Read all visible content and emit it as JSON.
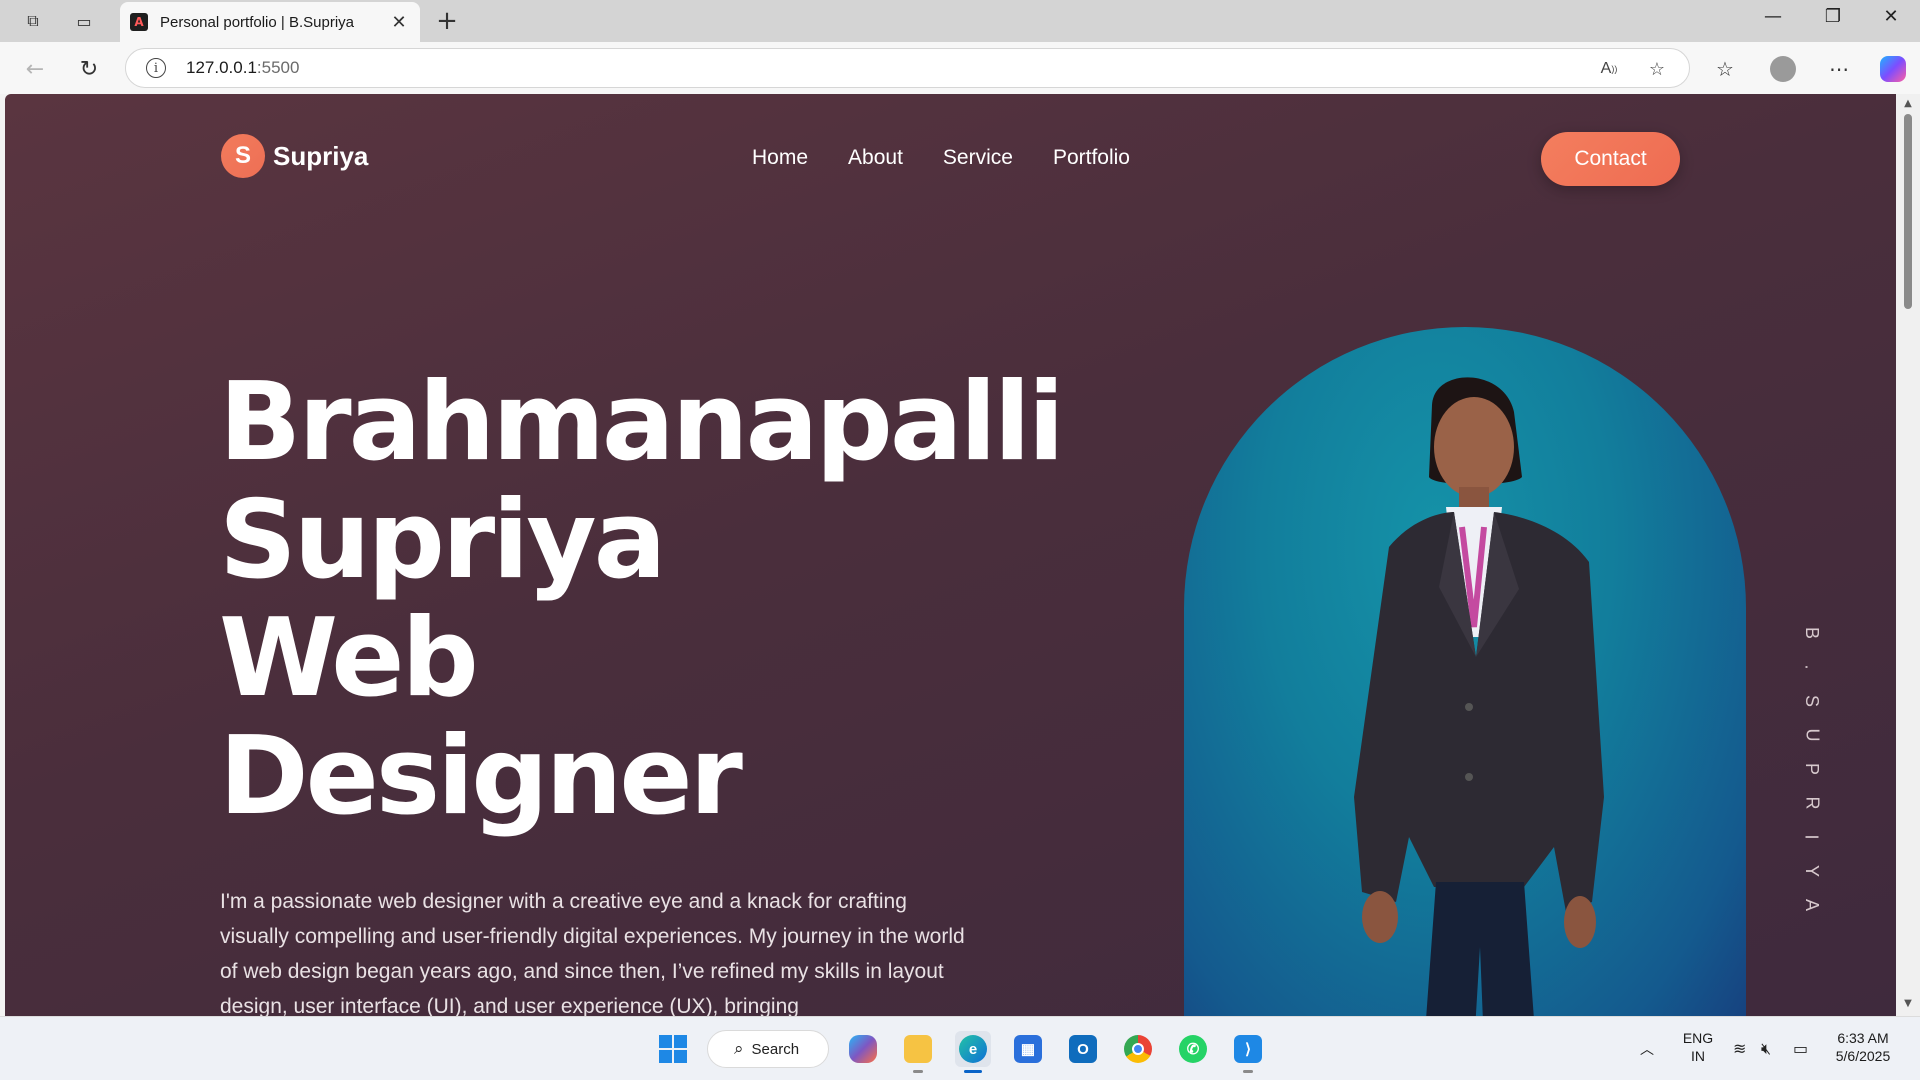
{
  "browser": {
    "tab": {
      "title": "Personal portfolio | B.Supriya",
      "favicon_letter": "A"
    },
    "new_tab_label": "+",
    "address": {
      "host": "127.0.0.1",
      "port": ":5500"
    },
    "window_controls": {
      "minimize": "—",
      "restore": "❐",
      "close": "✕"
    }
  },
  "site": {
    "logo": {
      "letter": "S",
      "name": "Supriya"
    },
    "menu": [
      {
        "label": "Home"
      },
      {
        "label": "About"
      },
      {
        "label": "Service"
      },
      {
        "label": "Portfolio"
      }
    ],
    "contact_button": "Contact",
    "hero": {
      "title_lines": [
        "Brahmanapalli",
        "Supriya",
        "Web",
        "Designer"
      ],
      "description": "I'm a passionate web designer with a creative eye and a knack for crafting visually compelling and user-friendly digital experiences. My journey in the world of web design began years ago, and since then, I’ve refined my skills in layout design, user interface (UI), and user experience (UX), bringing"
    },
    "vertical_name": [
      "B",
      ".",
      "S",
      "U",
      "P",
      "R",
      "I",
      "Y",
      "A"
    ],
    "colors": {
      "background": "#4a2e3c",
      "accent": "#f07557",
      "arch": "#127e9c"
    }
  },
  "taskbar": {
    "search_label": "Search",
    "language": {
      "line1": "ENG",
      "line2": "IN"
    },
    "clock": {
      "time": "6:33 AM",
      "date": "5/6/2025"
    },
    "apps": [
      "start-icon",
      "copilot-icon",
      "file-explorer-icon",
      "edge-icon",
      "store-icon",
      "outlook-icon",
      "chrome-icon",
      "whatsapp-icon",
      "vscode-icon"
    ]
  }
}
